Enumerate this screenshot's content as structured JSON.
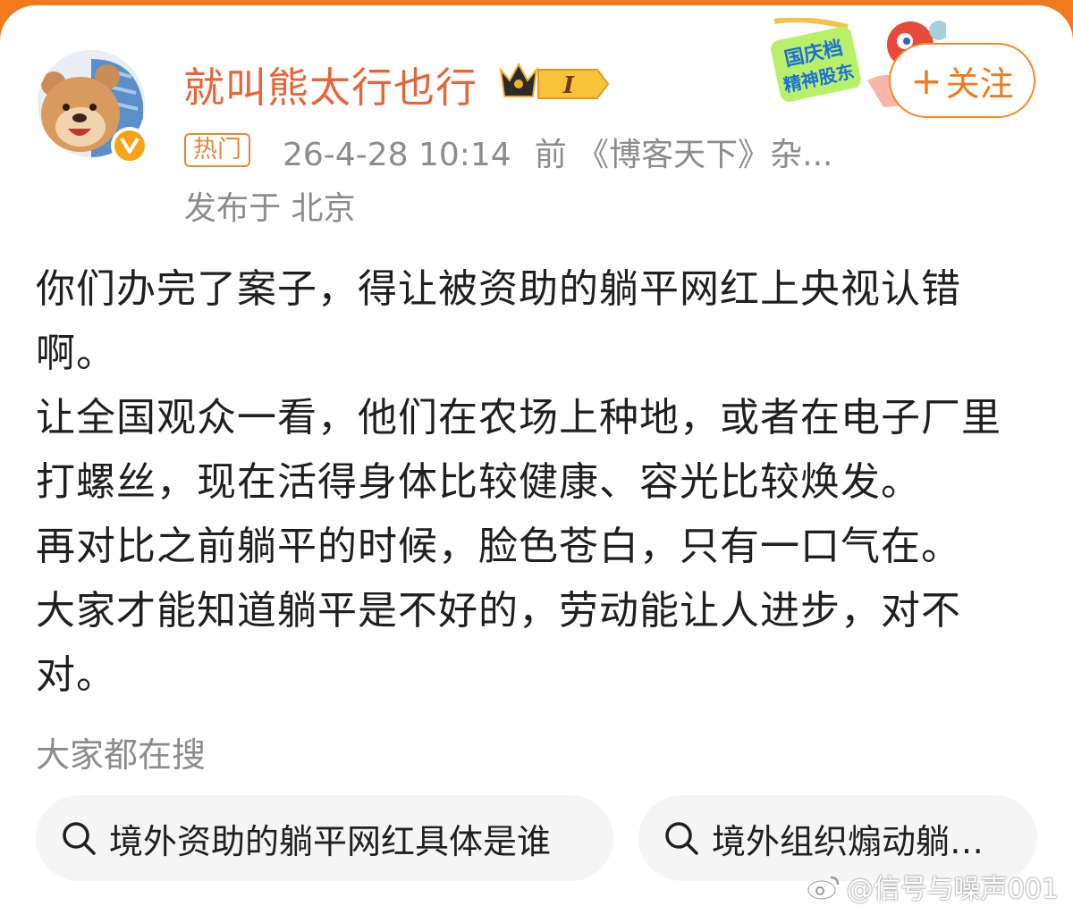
{
  "post": {
    "username": "就叫熊太行也行",
    "vip_level": "I",
    "hot_tag": "热门",
    "timestamp": "26-4-28 10:14",
    "source": "前 《博客天下》杂...",
    "location": "发布于 北京",
    "paragraphs": [
      "你们办完了案子，得让被资助的躺平网红上央视认错啊。",
      "让全国观众一看，他们在农场上种地，或者在电子厂里打螺丝，现在活得身体比较健康、容光比较焕发。",
      "再对比之前躺平的时候，脸色苍白，只有一口气在。",
      "大家才能知道躺平是不好的，劳动能让人进步，对不对。"
    ]
  },
  "header": {
    "follow_plus": "+",
    "follow_label": "关注",
    "promo_text_line1": "国庆档",
    "promo_text_line2": "精神股东"
  },
  "search": {
    "heading": "大家都在搜",
    "items": [
      "境外资助的躺平网红具体是谁",
      "境外组织煽动躺…"
    ]
  },
  "watermark": "@信号与噪声001",
  "colors": {
    "brand_orange": "#f07a1e",
    "username": "#e4663a",
    "meta_gray": "#8c8c8c",
    "pill_bg": "#f5f5f5"
  },
  "icons": {
    "search": "search-icon",
    "verified": "verified-v-icon",
    "crown": "crown-icon",
    "weibo": "weibo-logo-icon"
  }
}
